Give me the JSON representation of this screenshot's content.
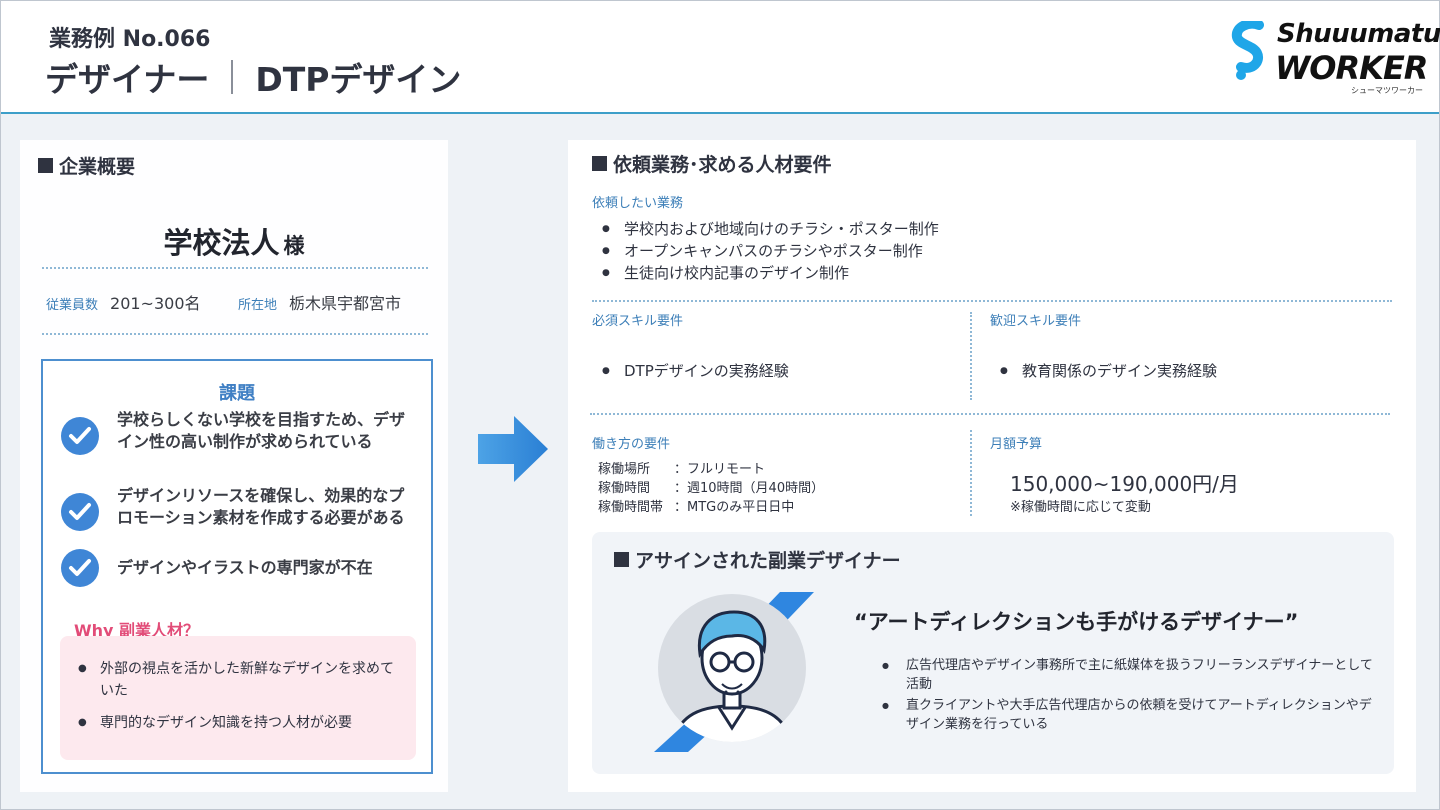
{
  "header": {
    "case_no": "業務例 No.066",
    "title_left": "デザイナー",
    "title_right": "DTPデザイン"
  },
  "logo": {
    "line1": "Shuuumatu",
    "line2": "WORKER",
    "kana": "シューマツワーカー",
    "accent_color": "#1fa6e8"
  },
  "company": {
    "section_title": "企業概要",
    "name": "学校法人",
    "honorific": "様",
    "employees_label": "従業員数",
    "employees_value": "201~300名",
    "location_label": "所在地",
    "location_value": "栃木県宇都宮市"
  },
  "issues": {
    "title": "課題",
    "items": [
      "学校らしくない学校を目指すため、デザイン性の高い制作が求められている",
      "デザインリソースを確保し、効果的なプロモーション素材を作成する必要がある",
      "デザインやイラストの専門家が不在"
    ],
    "why_title": "Why 副業人材？",
    "why_items": [
      "外部の視点を活かした新鮮なデザインを求めていた",
      "専門的なデザイン知識を持つ人材が必要"
    ]
  },
  "request": {
    "section_title": "依頼業務･求める人材要件",
    "tasks_label": "依頼したい業務",
    "tasks": [
      "学校内および地域向けのチラシ・ポスター制作",
      "オープンキャンパスのチラシやポスター制作",
      "生徒向け校内記事のデザイン制作"
    ],
    "required_label": "必須スキル要件",
    "required": [
      "DTPデザインの実務経験"
    ],
    "welcome_label": "歓迎スキル要件",
    "welcome": [
      "教育関係のデザイン実務経験"
    ],
    "work_label": "働き方の要件",
    "work_rows": [
      {
        "key": "稼働場所",
        "value": "：フルリモート"
      },
      {
        "key": "稼働時間",
        "value": "：週10時間（月40時間）"
      },
      {
        "key": "稼働時間帯",
        "value": "：MTGのみ平日日中"
      }
    ],
    "budget_label": "月額予算",
    "budget_value": "150,000~190,000円/月",
    "budget_note": "※稼働時間に応じて変動"
  },
  "assigned": {
    "section_title": "アサインされた副業デザイナー",
    "quote": "“アートディレクションも手がけるデザイナー”",
    "items": [
      "広告代理店やデザイン事務所で主に紙媒体を扱うフリーランスデザイナーとして活動",
      "直クライアントや大手広告代理店からの依頼を受けてアートディレクションやデザイン業務を行っている"
    ]
  },
  "colors": {
    "accent_blue": "#3f7fc4",
    "label_blue": "#3d7fb8",
    "why_pink": "#e24c78",
    "why_bg": "#fde9ee"
  }
}
